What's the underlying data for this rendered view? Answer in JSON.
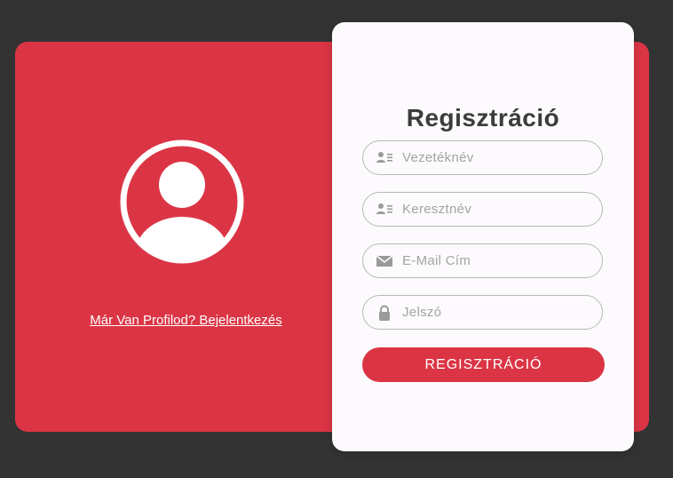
{
  "colors": {
    "background": "#333333",
    "accent": "#db3545",
    "card": "#fcfafc",
    "title": "#3c3c3c",
    "placeholder": "#a4a4a4",
    "icon": "#9a9a9a"
  },
  "left_panel": {
    "avatar_icon": "user-avatar-icon",
    "login_link": "Már Van Profilod? Bejelentkezés"
  },
  "form": {
    "title": "Regisztráció",
    "fields": {
      "last_name": {
        "placeholder": "Vezetéknév",
        "value": "",
        "icon": "id-card-icon"
      },
      "first_name": {
        "placeholder": "Keresztnév",
        "value": "",
        "icon": "id-card-icon"
      },
      "email": {
        "placeholder": "E-Mail Cím",
        "value": "",
        "icon": "envelope-icon"
      },
      "password": {
        "placeholder": "Jelszó",
        "value": "",
        "icon": "lock-icon"
      }
    },
    "submit_label": "REGISZTRÁCIÓ"
  }
}
